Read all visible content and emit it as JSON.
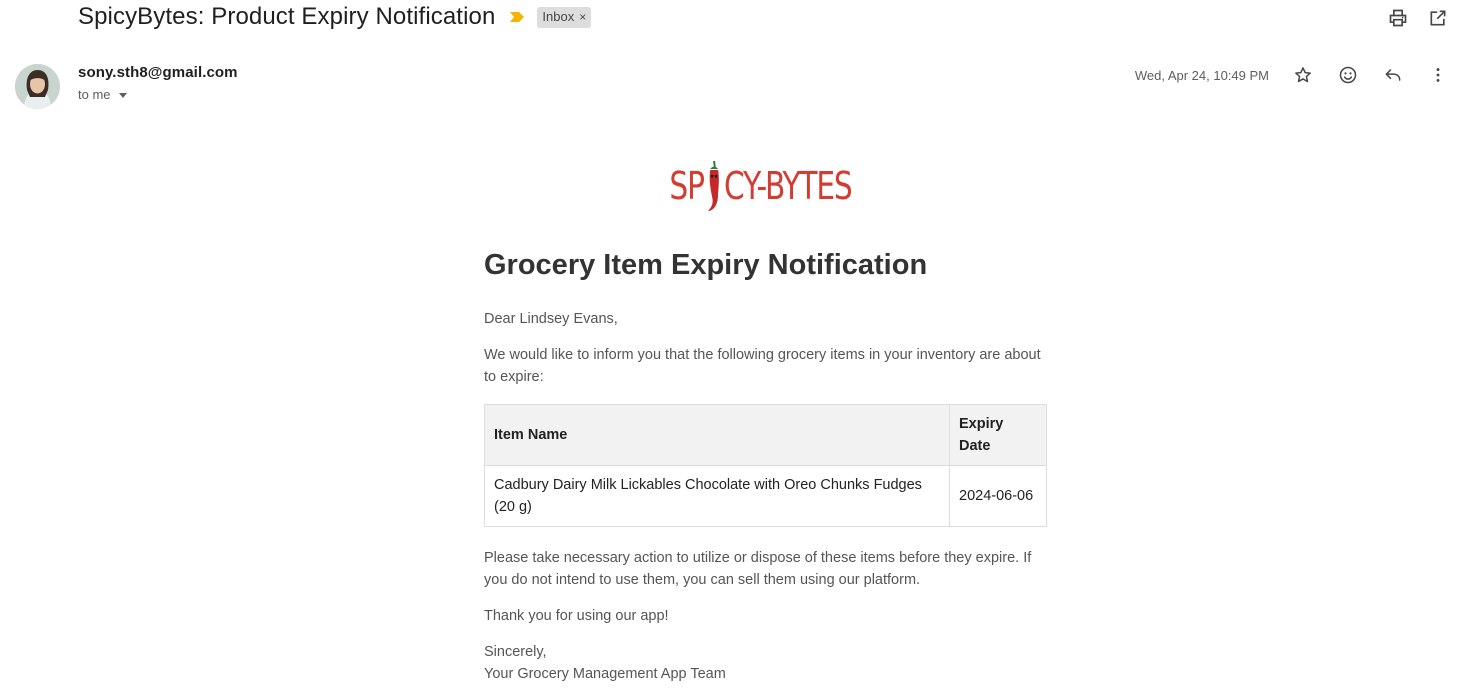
{
  "header": {
    "subject": "SpicyBytes: Product Expiry Notification",
    "label": "Inbox",
    "label_remove": "×"
  },
  "top_actions": [
    "printer-icon",
    "open-in-new-window-icon"
  ],
  "sender": {
    "email": "sony.sth8@gmail.com",
    "recipient": "to me",
    "date": "Wed, Apr 24, 10:49 PM"
  },
  "meta_icons": [
    "star-icon",
    "emoji-icon",
    "reply-icon",
    "more-vert-icon"
  ],
  "email": {
    "logo_text_left": "SP",
    "logo_text_right": "CY-BYTES",
    "heading": "Grocery Item Expiry Notification",
    "greeting": "Dear Lindsey Evans,",
    "intro": "We would like to inform you that the following grocery items in your inventory are about to expire:",
    "table": {
      "headers": [
        "Item Name",
        "Expiry Date"
      ],
      "rows": [
        [
          "Cadbury Dairy Milk Lickables Chocolate with Oreo Chunks Fudges (20 g)",
          "2024-06-06"
        ]
      ]
    },
    "action": "Please take necessary action to utilize or dispose of these items before they expire. If you do not intend to use them, you can sell them using our platform.",
    "thanks": "Thank you for using our app!",
    "signoff": "Sincerely,",
    "team": "Your Grocery Management App Team"
  },
  "colors": {
    "brand_red": "#d23c32",
    "expiry_red": "#d9534f",
    "importance_yellow": "#f4b400"
  }
}
